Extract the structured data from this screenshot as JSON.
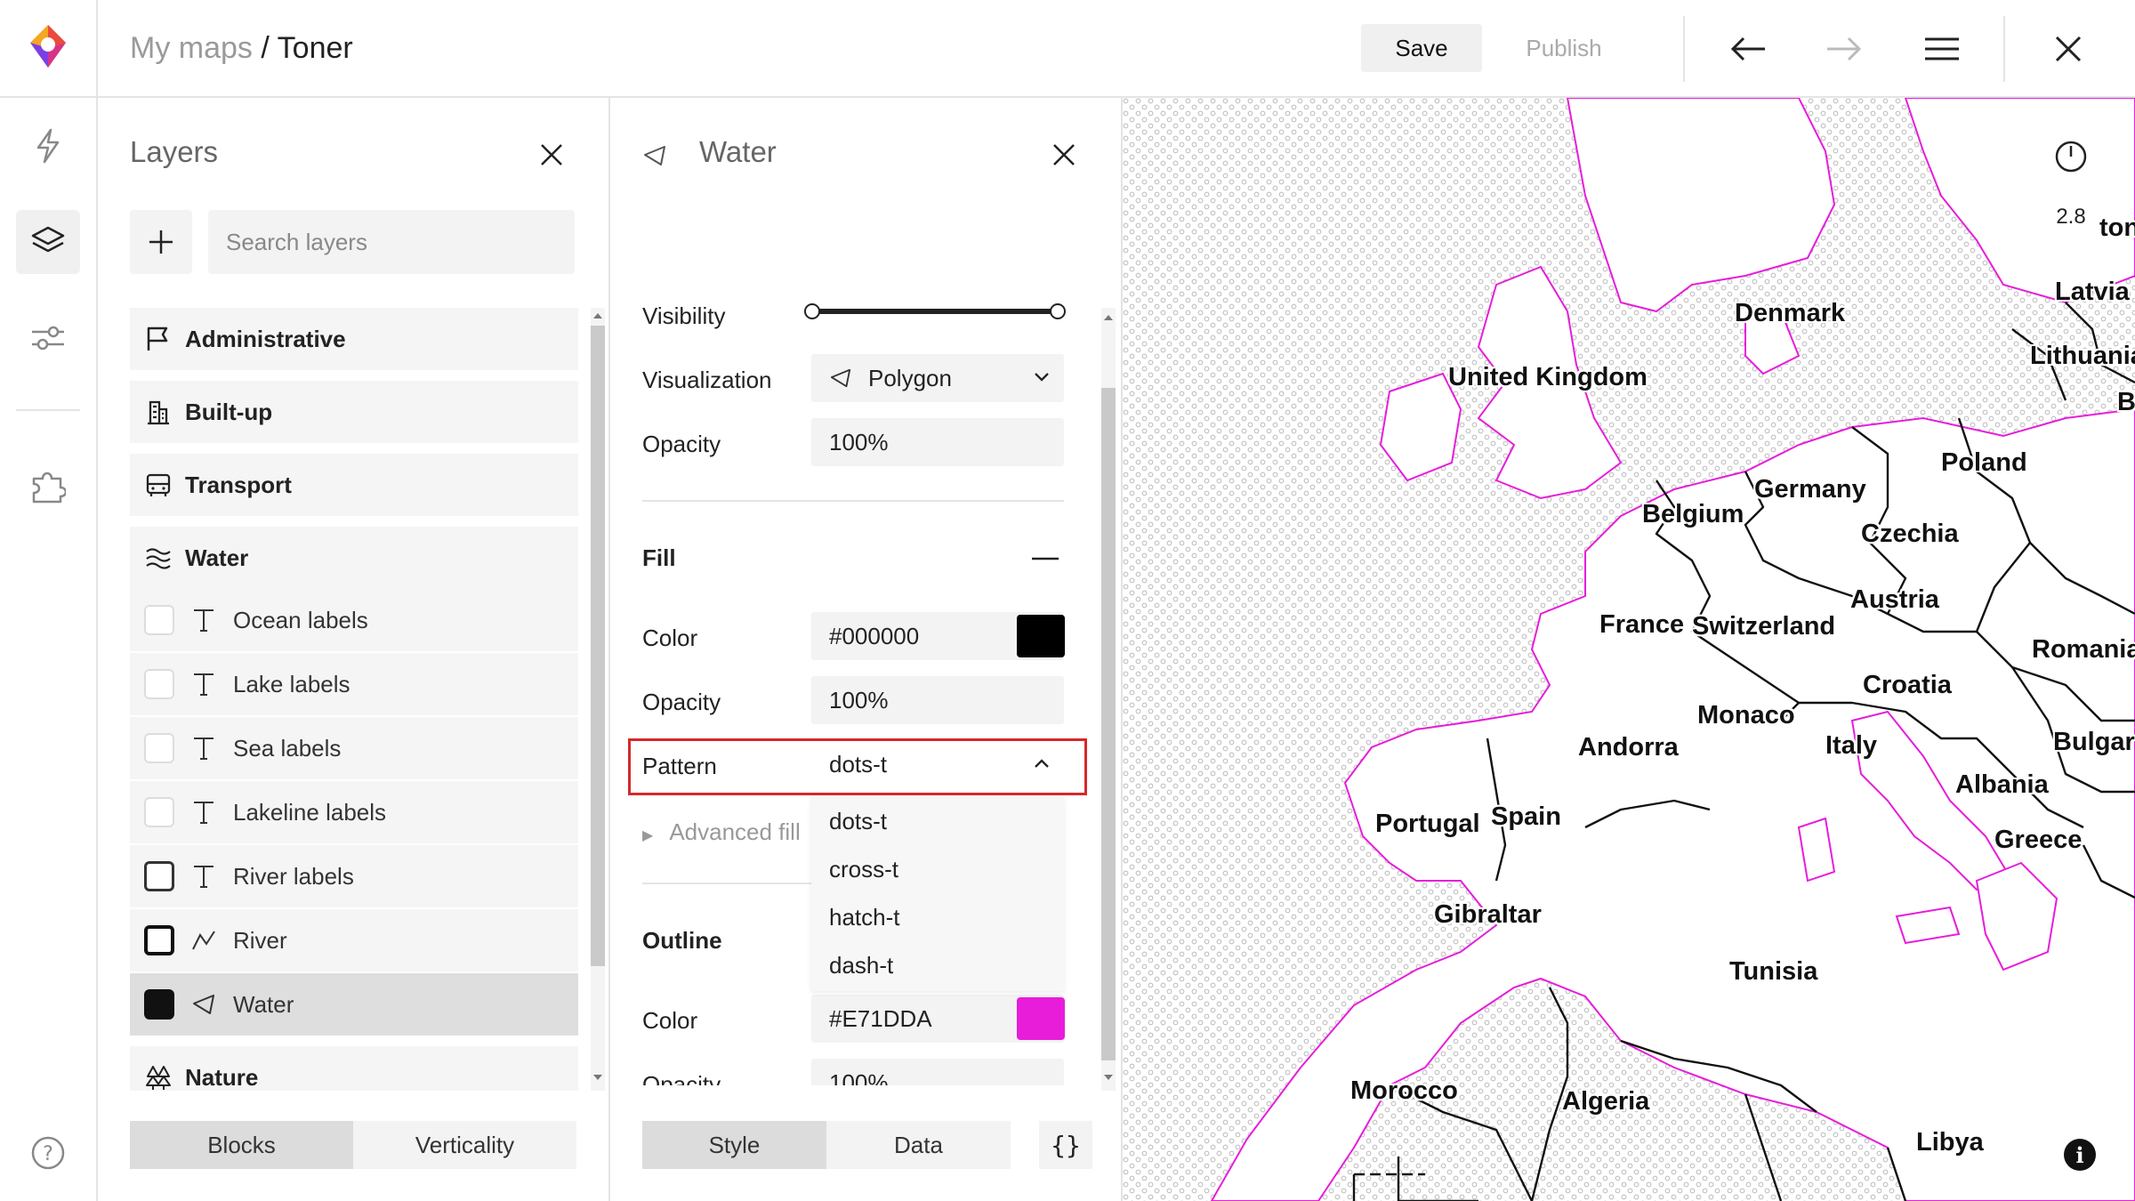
{
  "header": {
    "breadcrumb_root": "My maps",
    "breadcrumb_sep": "/",
    "breadcrumb_current": "Toner",
    "save_label": "Save",
    "publish_label": "Publish"
  },
  "rail": {
    "items": [
      "bolt-icon",
      "layers-icon",
      "sliders-icon",
      "puzzle-icon"
    ],
    "help_icon": "help-icon"
  },
  "layers_panel": {
    "title": "Layers",
    "search_placeholder": "Search layers",
    "groups": {
      "administrative": "Administrative",
      "builtup": "Built-up",
      "transport": "Transport",
      "water": "Water",
      "nature": "Nature"
    },
    "water_layers": [
      {
        "label": "Ocean labels",
        "type": "text"
      },
      {
        "label": "Lake labels",
        "type": "text"
      },
      {
        "label": "Sea labels",
        "type": "text"
      },
      {
        "label": "Lakeline labels",
        "type": "text"
      },
      {
        "label": "River labels",
        "type": "text"
      },
      {
        "label": "River",
        "type": "line"
      },
      {
        "label": "Water",
        "type": "polygon"
      }
    ],
    "tabs": [
      "Blocks",
      "Verticality"
    ]
  },
  "props_panel": {
    "title": "Water",
    "visibility_label": "Visibility",
    "visualization_label": "Visualization",
    "visualization_value": "Polygon",
    "opacity_label": "Opacity",
    "opacity_value": "100%",
    "fill_section": "Fill",
    "fill_color_label": "Color",
    "fill_color_value": "#000000",
    "fill_opacity_label": "Opacity",
    "fill_opacity_value": "100%",
    "pattern_label": "Pattern",
    "pattern_value": "dots-t",
    "pattern_options": [
      "dots-t",
      "cross-t",
      "hatch-t",
      "dash-t"
    ],
    "advanced_fill": "Advanced fill",
    "outline_section": "Outline",
    "outline_color_label": "Color",
    "outline_color_value": "#E71DDA",
    "outline_opacity_label": "Opacity",
    "outline_opacity_value": "100%",
    "tabs": [
      "Style",
      "Data"
    ],
    "code_button": "{}"
  },
  "map": {
    "zoom": "2.8",
    "countries": [
      "Denmark",
      "Latvia",
      "Lithuania",
      "United Kingdom",
      "Poland",
      "Germany",
      "Belgium",
      "Czechia",
      "Austria",
      "France",
      "Switzerland",
      "Romania",
      "Croatia",
      "Monaco",
      "Italy",
      "Andorra",
      "Bulgar",
      "Albania",
      "Portugal",
      "Spain",
      "Greece",
      "Gibraltar",
      "Tunisia",
      "Morocco",
      "Algeria",
      "Libya",
      "B",
      "ton"
    ]
  },
  "colors": {
    "fill": "#000000",
    "outline": "#E71DDA",
    "highlight": "#D42A2A"
  }
}
